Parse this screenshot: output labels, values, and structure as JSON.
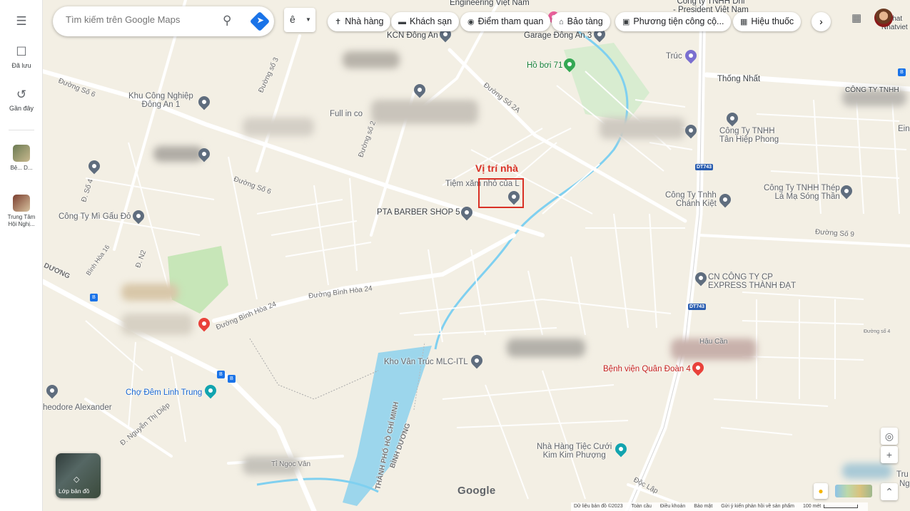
{
  "rail": {
    "saved": "Đã lưu",
    "recent": "Gần đây",
    "recent_item1": "Bệ... D...",
    "recent_item2": "Trung Tâm Hội Nghị..."
  },
  "search": {
    "placeholder": "Tìm kiếm trên Google Maps"
  },
  "lang_char": "ê",
  "chips": [
    {
      "icon": "restaurant-icon",
      "label": "Nhà hàng"
    },
    {
      "icon": "hotel-icon",
      "label": "Khách sạn"
    },
    {
      "icon": "camera-icon",
      "label": "Điểm tham quan"
    },
    {
      "icon": "museum-icon",
      "label": "Bảo tàng"
    },
    {
      "icon": "transit-icon",
      "label": "Phương tiện công cộ..."
    },
    {
      "icon": "pharmacy-icon",
      "label": "Hiệu thuốc"
    }
  ],
  "annotation": {
    "title": "Vị trí nhà"
  },
  "labels": {
    "kcn": "KCN Đông An",
    "garage": "Garage Đông An 3",
    "hoboi": "Hồ bơi 71",
    "thongnhat": "Thống Nhất",
    "khucn": "Khu Công Nghiệp\nĐông An 1",
    "fullin": "Full in co",
    "tanhiep": "Công Ty TNHH\nTân Hiệp Phong",
    "tiem": "Tiệm xăm nhỏ của L",
    "pta": "PTA BARBER SHOP 5",
    "chanhkiet": "Công Ty Tnhh\nChánh Kiệt",
    "thep": "Công Ty TNHH Thép\nLá Mạ Sóng Thần",
    "migau": "Công Ty Mì Gấu Đỏ",
    "express": "CN CÔNG TY CP\nEXPRESS THÀNH ĐẠT",
    "khovan": "Kho Vân Trúc MLC-ITL",
    "benhvien": "Bệnh viện Quân Đoàn 4",
    "chodem": "Chợ Đêm Linh Trung",
    "theodore": "heodore Alexander",
    "nhahang": "Nhà Hàng Tiệc Cưới\nKim Kim Phượng",
    "hcm": "THÀNH PHỐ HỒ CHÍ MINH",
    "binhduong": "BÌNH DƯƠNG",
    "congty_dv": "Công ty TNHH Dhl\n- President Việt Nam",
    "road_so6": "Đường Số 6",
    "road_so6b": "Đường Số 6",
    "road_so3": "Đường số 3",
    "road_so2": "Đường số 2",
    "road_so2a": "Đường Số 2A",
    "road_bh24": "Đường Bình Hòa 24",
    "road_bh24b": "Đường Bình Hòa 24",
    "road_so9": "Đường Số 9",
    "road_ntd": "Đ. Nguyễn Thị Diệp",
    "road_so4": "Đ. Số 4",
    "road_duong": "DƯƠNG",
    "road_doclap": "Độc Lập",
    "road_dt743": "DT743",
    "road_dt743b": "DT743",
    "road_tvan": "Tỉ Ngọc Vân",
    "road_n2": "Đ. N2",
    "road_bh16": "Bình Hòa 16",
    "eng": "Engineering Việt Nam",
    "ein": "Ein",
    "cty_tnh": "CÔNG TY TNHH",
    "nhat": "Nhat",
    "nhatviet": "Nhatviet",
    "tru": "Tru",
    "ng": "Ng",
    "da": "Đường số 4",
    "truc": "Trúc",
    "hau": "Hậu Cần"
  },
  "layers_label": "Lớp bản đồ",
  "google": "Google",
  "footer": {
    "data": "Dữ liệu bản đồ ©2023",
    "global": "Toàn cầu",
    "terms": "Điều khoản",
    "privacy": "Bảo mật",
    "feedback": "Gửi ý kiến phản hồi về sản phẩm",
    "scale": "100 mét"
  },
  "colors": {
    "map_bg": "#f3efe4",
    "road": "#ffffff",
    "water": "#9cd6ec",
    "river": "#7fd0f0",
    "park": "#c7e6b8",
    "annotation": "#d93025"
  }
}
